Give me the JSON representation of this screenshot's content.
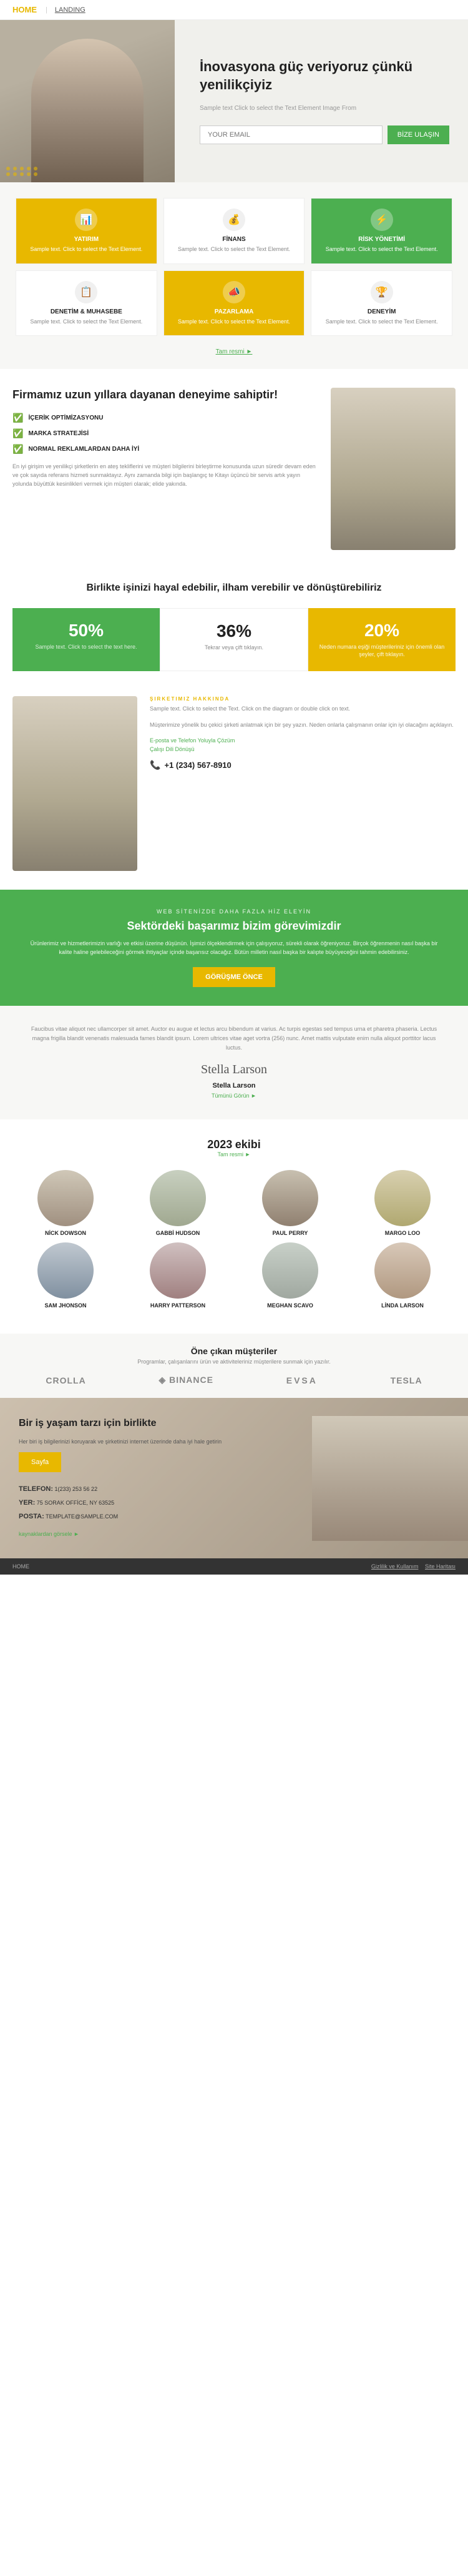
{
  "nav": {
    "logo": "HOME",
    "link": "LANDING"
  },
  "hero": {
    "title": "İnovasyona güç veriyoruz çünkü yenilikçiyiz",
    "sample_text": "Sample text Click to select the Text Element Image From",
    "input_placeholder": "YOUR EMAIL",
    "btn_label": "BİZE ULAŞIN"
  },
  "services": {
    "row1": [
      {
        "icon": "📊",
        "title": "YATIRIM",
        "text": "Sample text. Click to select the Text Element.",
        "type": "gold"
      },
      {
        "icon": "💰",
        "title": "FİNANS",
        "text": "Sample text. Click to select the Text Element.",
        "type": "white"
      },
      {
        "icon": "⚡",
        "title": "RİSK YÖNETİMİ",
        "text": "Sample text. Click to select the Text Element.",
        "type": "green"
      }
    ],
    "row2": [
      {
        "icon": "📋",
        "title": "DENETİM & MUHASEBE",
        "text": "Sample text. Click to select the Text Element.",
        "type": "white"
      },
      {
        "icon": "📣",
        "title": "PAZARLAMA",
        "text": "Sample text. Click to select the Text Element.",
        "type": "gold"
      },
      {
        "icon": "🏆",
        "title": "DENEYİM",
        "text": "Sample text. Click to select the Text Element.",
        "type": "white"
      }
    ],
    "more_label": "Tam resmi ►"
  },
  "about": {
    "title": "Firmamız uzun yıllara dayanan deneyime sahiptir!",
    "checks": [
      "İÇERİK OPTİMİZASYONU",
      "MARKA STRATEJİSİ",
      "NORMAL REKLAMLARDAN DAHA İYİ"
    ],
    "desc": "En iyi girişim ve yenilikçi şirketlerin en ateş tekliflerini ve müşteri bilgilerini birleştirme konusunda uzun süredir devam eden ve çok sayıda referans hizmeti sunmaktayız. Aynı zamanda bilgi için başlangıç te Kitayı üçüncü bir servis artık yayın yolunda büyüttük kesinlikleri vermek için müşteri olarak; elide yakında."
  },
  "stats": {
    "section_title": "Birlikte işinizi hayal edebilir, ilham verebilir ve dönüştürebiliriz",
    "items": [
      {
        "number": "50%",
        "label": "Sample text. Click to select the text here.",
        "type": "green"
      },
      {
        "number": "36%",
        "label": "Tekrar veya çift tıklayın.",
        "type": "white"
      },
      {
        "number": "20%",
        "label": "Neden numara eşiği müşterileriniz için önemli olan şeyler, çift tıklayın.",
        "type": "gold"
      }
    ]
  },
  "company": {
    "section_label": "Şirketimiz Hakkında",
    "desc1": "Sample text. Click to select the Text. Click on the diagram or double click on text.",
    "desc2": "Müşterimize yönelik bu çekici şirketi anlatmak için bir şey yazın. Neden onlarla çalışmanın onlar için iyi olacağını açıklayın.",
    "link1": "E-posta ve Telefon Yoluyla Çözüm",
    "link2": "Çalışı Dili Dönüşü",
    "phone": "+1 (234) 567-8910"
  },
  "cta": {
    "subtitle": "WEB SİTENİZDE DAHA FAZLA HİZ ELEYİN",
    "title": "Sektördeki başarımız bizim görevimizdir",
    "desc": "Ürünlerimiz ve hizmetlerimizin varlığı ve etkisi üzerine düşünün. İşimizi ölçeklendirmek için çalışıyoruz, sürekli olarak öğreniyoruz. Birçok öğrenmenin nasıl başka bir kalite haline gelebileceğini görmek ihtiyaçlar içinde başarısız olacağız. Bütün milletin nasıl başka bir kalıpte büyüyeceğini tahmin edebilirsiniz.",
    "btn_label": "GÖRÜŞME ÖNCE"
  },
  "quote": {
    "desc": "Faucibus vitae aliquot nec ullamcorper sit amet. Auctor eu augue et lectus arcu bibendum at varius. Ac turpis egestas sed tempus urna et pharetra phaseria. Lectus magna frigilla blandit venenatis malesuada fames blandit ipsum. Lorem ultrices vitae aget vortra (256) nunc. Amet mattis vulputate enim nulla aliquot porttitor lacus luctus.",
    "signature": "Stella Larson",
    "author": "Stella Larson",
    "role": "Tümünü Görün ►"
  },
  "team": {
    "year": "2023",
    "subtitle": "ekibi",
    "more_label": "Tam resmi ►",
    "members": [
      {
        "name": "NİCK DOWSON"
      },
      {
        "name": "GABBİ HUDSON"
      },
      {
        "name": "PAUL PERRY"
      },
      {
        "name": "MARGO LOO"
      },
      {
        "name": "SAM JHONSON"
      },
      {
        "name": "HARRY PATTERSON"
      },
      {
        "name": "MEGHAN SCAVO"
      },
      {
        "name": "LİNDA LARSON"
      }
    ]
  },
  "clients": {
    "title": "Öne çıkan müşteriler",
    "desc": "Programlar, çalışanlarını ürün ve aktiviteleriniz müşterilere sunmak için yazılır.",
    "logos": [
      "CROLLA",
      "◈ BINANCE",
      "EVSA",
      "TESLA"
    ]
  },
  "footer_cta": {
    "title": "Bir iş yaşam tarzı için birlikte",
    "desc": "Her biri iş bilgilerinizi koruyarak ve şirketinizi internet üzerinde daha iyi hale getirin",
    "btn_label": "Sayfa",
    "phone_label": "TELEFON:",
    "phone_value": "1(233) 253 56 22",
    "address_label": "YER:",
    "address_value": "75 SORAK OFFİCE, NY 63525",
    "email_label": "POSTA:",
    "email_value": "TEMPLATE@SAMPLE.COM",
    "nav_label": "kaynaklardan görsele ►"
  },
  "bottom_nav": {
    "left": "HOME",
    "links": [
      "Gizlilik ve Kullanım",
      "Site Haritası"
    ]
  }
}
